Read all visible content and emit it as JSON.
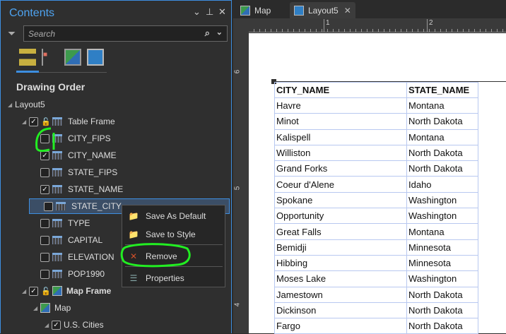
{
  "contents": {
    "title": "Contents",
    "search_placeholder": "Search",
    "heading": "Drawing Order",
    "tree": [
      {
        "label": "Layout5",
        "level": 0,
        "checkbox": null
      },
      {
        "label": "Table Frame",
        "level": 1,
        "checkbox": true,
        "icon": "table",
        "bold": false
      },
      {
        "label": "CITY_FIPS",
        "level": 2,
        "checkbox": false,
        "icon": "table"
      },
      {
        "label": "CITY_NAME",
        "level": 2,
        "checkbox": true,
        "icon": "table"
      },
      {
        "label": "STATE_FIPS",
        "level": 2,
        "checkbox": false,
        "icon": "table"
      },
      {
        "label": "STATE_NAME",
        "level": 2,
        "checkbox": true,
        "icon": "table"
      },
      {
        "label": "STATE_CITY",
        "level": 2,
        "checkbox": false,
        "icon": "table",
        "selected": true
      },
      {
        "label": "TYPE",
        "level": 2,
        "checkbox": false,
        "icon": "table"
      },
      {
        "label": "CAPITAL",
        "level": 2,
        "checkbox": false,
        "icon": "table"
      },
      {
        "label": "ELEVATION",
        "level": 2,
        "checkbox": false,
        "icon": "table"
      },
      {
        "label": "POP1990",
        "level": 2,
        "checkbox": false,
        "icon": "table"
      },
      {
        "label": "Map Frame",
        "level": 1,
        "checkbox": true,
        "icon": "map",
        "bold": true
      },
      {
        "label": "Map",
        "level": 2,
        "checkbox": null,
        "icon": "map"
      },
      {
        "label": "U.S. Cities",
        "level": 3,
        "checkbox": true
      }
    ]
  },
  "context_menu": [
    {
      "label": "Save As Default",
      "icon": "save-default-icon"
    },
    {
      "label": "Save to Style",
      "icon": "save-style-icon"
    },
    {
      "label": "Remove",
      "icon": "remove-icon"
    },
    {
      "label": "Properties",
      "icon": "properties-icon"
    }
  ],
  "tabs": [
    {
      "label": "Map"
    },
    {
      "label": "Layout5",
      "active": true
    }
  ],
  "ruler": {
    "top": [
      "1",
      "2"
    ],
    "left": [
      "6",
      "5",
      "4"
    ]
  },
  "table": {
    "headers": [
      "CITY_NAME",
      "STATE_NAME"
    ],
    "rows": [
      [
        "Havre",
        "Montana"
      ],
      [
        "Minot",
        "North Dakota"
      ],
      [
        "Kalispell",
        "Montana"
      ],
      [
        "Williston",
        "North Dakota"
      ],
      [
        "Grand Forks",
        "North Dakota"
      ],
      [
        "Coeur d'Alene",
        "Idaho"
      ],
      [
        "Spokane",
        "Washington"
      ],
      [
        "Opportunity",
        "Washington"
      ],
      [
        "Great Falls",
        "Montana"
      ],
      [
        "Bemidji",
        "Minnesota"
      ],
      [
        "Hibbing",
        "Minnesota"
      ],
      [
        "Moses Lake",
        "Washington"
      ],
      [
        "Jamestown",
        "North Dakota"
      ],
      [
        "Dickinson",
        "North Dakota"
      ],
      [
        "Fargo",
        "North Dakota"
      ]
    ]
  },
  "colors": {
    "accent": "#3d8ee0",
    "highlight": "#22ee22"
  }
}
